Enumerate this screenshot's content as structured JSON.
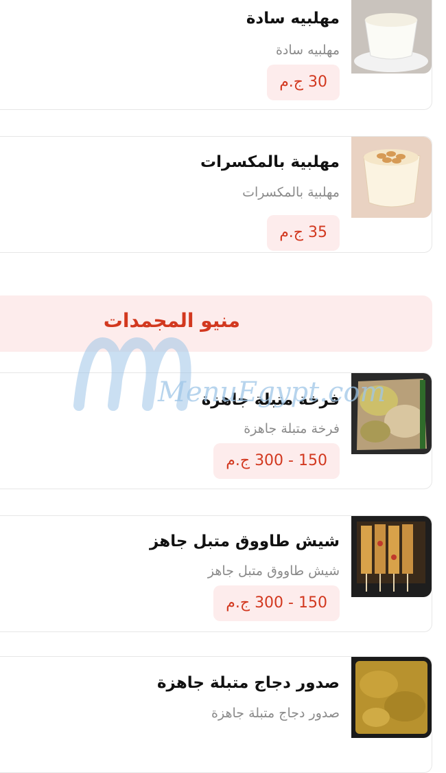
{
  "items_before": [
    {
      "name": "مهلبيه سادة",
      "desc": "مهلبيه سادة",
      "price": "30 ج.م",
      "image": "muhallabia-plain"
    },
    {
      "name": "مهلبية بالمكسرات",
      "desc": "مهلبية بالمكسرات",
      "price": "35 ج.م",
      "image": "muhallabia-nuts"
    }
  ],
  "section": {
    "title": "منيو المجمدات"
  },
  "watermark": {
    "text": "MenuEgypt.com"
  },
  "items_after": [
    {
      "name": "فرخة متبلة جاهزة",
      "desc": "فرخة متبلة جاهزة",
      "price": "150 - 300 ج.م",
      "image": "marinated-chicken"
    },
    {
      "name": "شيش طاووق متبل جاهز",
      "desc": "شيش طاووق متبل جاهز",
      "price": "150 - 300 ج.م",
      "image": "shish-tawook"
    },
    {
      "name": "صدور دجاج متبلة جاهزة",
      "desc": "صدور دجاج متبلة جاهزة",
      "price": "",
      "image": "chicken-breasts"
    }
  ],
  "colors": {
    "accent": "#d2381f",
    "price_bg": "#fdecec",
    "border": "#e6e6e6"
  }
}
